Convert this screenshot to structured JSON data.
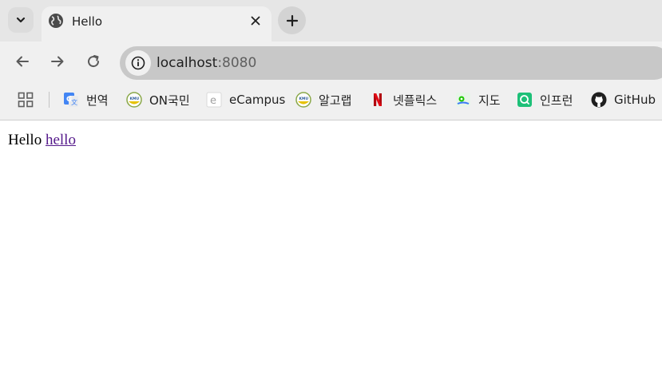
{
  "tab": {
    "title": "Hello"
  },
  "toolbar": {
    "url_host": "localhost",
    "url_port": ":8080"
  },
  "bookmarks": [
    {
      "label": "번역",
      "icon": "google-translate-icon"
    },
    {
      "label": "ON국민",
      "icon": "kmu-logo-icon"
    },
    {
      "label": "eCampus",
      "icon": "ecampus-icon"
    },
    {
      "label": "알고랩",
      "icon": "kmu-logo-icon"
    },
    {
      "label": "넷플릭스",
      "icon": "netflix-icon"
    },
    {
      "label": "지도",
      "icon": "maps-icon"
    },
    {
      "label": "인프런",
      "icon": "inflearn-icon"
    },
    {
      "label": "GitHub",
      "icon": "github-icon"
    }
  ],
  "page": {
    "text": "Hello",
    "link_text": "hello"
  },
  "colors": {
    "link": "#551a8b",
    "netflix": "#e50914",
    "inflearn": "#1dc078"
  }
}
